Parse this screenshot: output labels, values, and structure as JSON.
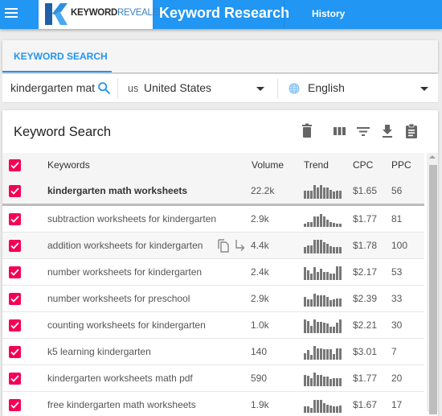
{
  "topbar": {
    "logo_kw": "KEYWORD",
    "logo_rv": "REVEALER",
    "title": "Keyword Research",
    "history": "History",
    "color": "#2196f3"
  },
  "tabs": [
    {
      "label": "KEYWORD SEARCH",
      "active": true
    }
  ],
  "search": {
    "keyword_value": "kindergarten mat",
    "country_code": "us",
    "country_name": "United States",
    "language": "English"
  },
  "card": {
    "title": "Keyword Search",
    "tools": [
      "trash-icon",
      "columns-icon",
      "filter-icon",
      "download-icon",
      "clipboard-icon"
    ]
  },
  "table": {
    "headers": {
      "keywords": "Keywords",
      "volume": "Volume",
      "trend": "Trend",
      "cpc": "CPC",
      "ppc": "PPC"
    },
    "rows": [
      {
        "keyword": "kindergarten math worksheets",
        "volume": "22.2k",
        "cpc": "$1.65",
        "ppc": "56",
        "checked": true,
        "trend": [
          0.6,
          0.6,
          0.6,
          1.0,
          0.8,
          1.0,
          0.85,
          0.85,
          0.65,
          0.5,
          0.6,
          0.6
        ]
      },
      {
        "keyword": "subtraction worksheets for kindergarten",
        "volume": "2.9k",
        "cpc": "$1.77",
        "ppc": "81",
        "checked": true,
        "trend": [
          0.25,
          0.35,
          0.35,
          0.75,
          0.75,
          0.95,
          0.75,
          0.55,
          0.35,
          0.3,
          0.25,
          0.25
        ]
      },
      {
        "keyword": "addition worksheets for kindergarten",
        "volume": "4.4k",
        "cpc": "$1.78",
        "ppc": "100",
        "checked": true,
        "trend": [
          0.45,
          0.6,
          0.6,
          1.0,
          1.0,
          1.0,
          0.85,
          0.7,
          0.55,
          0.45,
          0.45,
          0.45
        ]
      },
      {
        "keyword": "number worksheets for kindergarten",
        "volume": "2.4k",
        "cpc": "$2.17",
        "ppc": "53",
        "checked": true,
        "trend": [
          0.95,
          0.7,
          0.45,
          0.95,
          0.6,
          0.8,
          0.6,
          0.6,
          0.45,
          0.45,
          1.0,
          1.0
        ]
      },
      {
        "keyword": "number worksheets for preschool",
        "volume": "2.9k",
        "cpc": "$2.39",
        "ppc": "33",
        "checked": true,
        "trend": [
          0.7,
          0.55,
          0.5,
          0.95,
          0.85,
          0.85,
          0.85,
          0.7,
          0.45,
          0.55,
          0.6,
          0.6
        ]
      },
      {
        "keyword": "counting worksheets for kindergarten",
        "volume": "1.0k",
        "cpc": "$2.21",
        "ppc": "30",
        "checked": true,
        "trend": [
          1.0,
          0.9,
          0.55,
          1.0,
          0.85,
          0.8,
          0.75,
          0.7,
          0.45,
          0.45,
          0.75,
          1.0
        ]
      },
      {
        "keyword": "k5 learning kindergarten",
        "volume": "140",
        "cpc": "$3.01",
        "ppc": "7",
        "checked": true,
        "trend": [
          0.45,
          0.7,
          0.35,
          1.0,
          0.8,
          0.8,
          0.75,
          0.75,
          0.75,
          0.4,
          0.8,
          0.8
        ]
      },
      {
        "keyword": "kindergarten worksheets math pdf",
        "volume": "590",
        "cpc": "$1.77",
        "ppc": "20",
        "checked": true,
        "trend": [
          0.8,
          0.75,
          0.6,
          1.0,
          0.8,
          0.8,
          0.7,
          0.7,
          0.5,
          0.6,
          0.6,
          0.6
        ]
      },
      {
        "keyword": "free kindergarten math worksheets",
        "volume": "1.9k",
        "cpc": "$1.67",
        "ppc": "17",
        "checked": true,
        "trend": [
          0.45,
          0.45,
          0.35,
          0.95,
          0.95,
          0.95,
          0.7,
          0.6,
          0.55,
          0.45,
          0.45,
          0.55
        ]
      }
    ]
  },
  "colors": {
    "accent": "#2196f3",
    "checkbox": "#f50057"
  }
}
